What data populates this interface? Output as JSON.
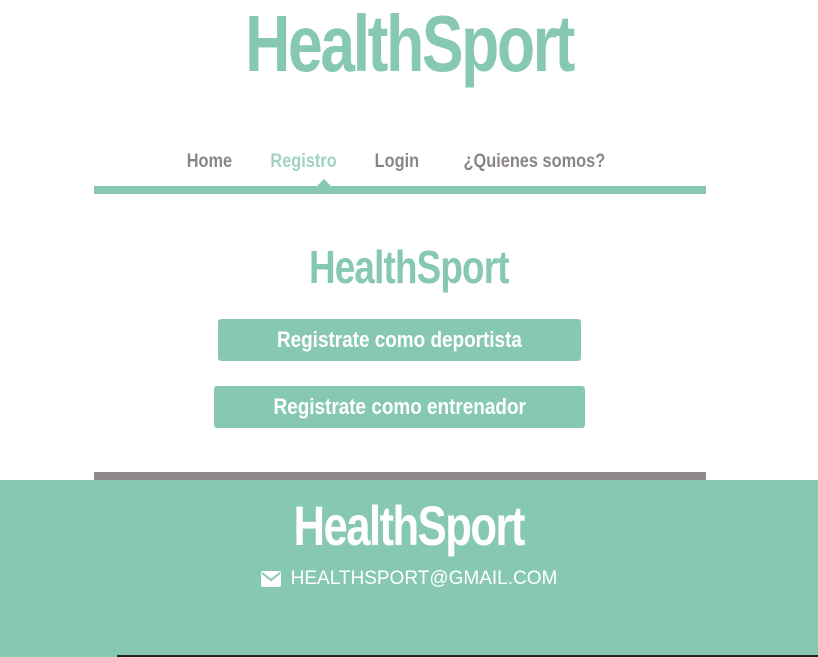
{
  "brand": {
    "name": "HealthSport",
    "color": "#86c8b4"
  },
  "nav": {
    "items": [
      {
        "label": "Home",
        "active": false
      },
      {
        "label": "Registro",
        "active": true
      },
      {
        "label": "Login",
        "active": false
      },
      {
        "label": "¿Quienes somos?",
        "active": false
      }
    ]
  },
  "main": {
    "title": "HealthSport",
    "buttons": {
      "athlete": "Registrate como deportista",
      "coach": "Registrate como entrenador"
    }
  },
  "footer": {
    "title": "HealthSport",
    "email_icon": "envelope-icon",
    "email": "HEALTHSPORT@GMAIL.COM"
  },
  "colors": {
    "accent": "#86c8b4",
    "nav_text": "#8b8685",
    "nav_active": "#9fd2c1",
    "divider": "#8e8a89",
    "footer_bg": "#86c8b4"
  }
}
